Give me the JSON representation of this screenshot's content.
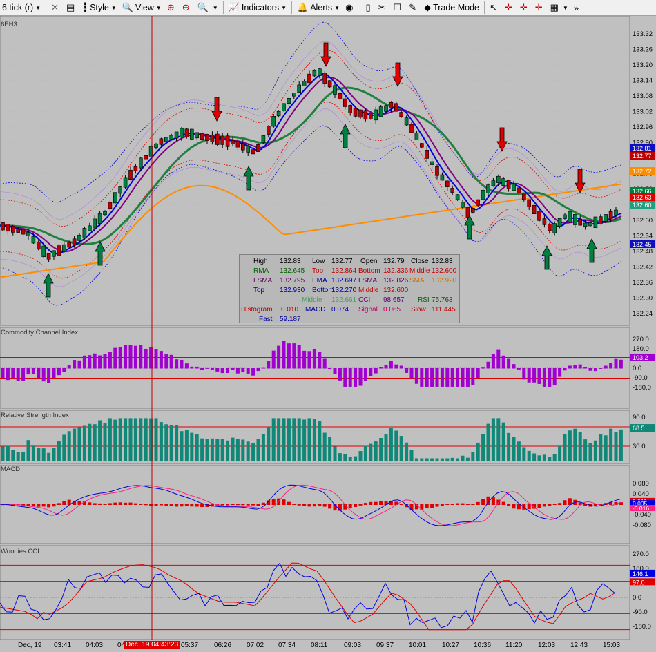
{
  "toolbar": {
    "period": "6 tick (r)",
    "style": "Style",
    "view": "View",
    "indicators": "Indicators",
    "alerts": "Alerts",
    "trade_mode": "Trade Mode"
  },
  "panels": {
    "price": {
      "label": "6EH3"
    },
    "cci": {
      "label": "Commodity Channel Index"
    },
    "rsi": {
      "label": "Relative Strength Index"
    },
    "macd": {
      "label": "MACD"
    },
    "woodies": {
      "label": "Woodies CCI"
    }
  },
  "price_axis": [
    "133.32",
    "133.26",
    "133.20",
    "133.14",
    "133.08",
    "133.02",
    "132.96",
    "132.90",
    "132.84",
    "132.78",
    "132.72",
    "132.66",
    "132.60",
    "132.54",
    "132.48",
    "132.42",
    "132.36",
    "132.30",
    "132.24"
  ],
  "price_boxes": [
    {
      "text": "132.81",
      "color": "#1010c0"
    },
    {
      "text": "132.77",
      "color": "#c00000"
    },
    {
      "text": "132.72",
      "color": "#ff8c00"
    },
    {
      "text": "132.66",
      "color": "#008040"
    },
    {
      "text": "132.63",
      "color": "#e00000"
    },
    {
      "text": "132.60",
      "color": "#20a080"
    },
    {
      "text": "132.45",
      "color": "#1010c0"
    }
  ],
  "cci_axis": [
    "270.0",
    "180.0",
    "90.0",
    "0.0",
    "-90.0",
    "-180.0"
  ],
  "cci_box": "103.2",
  "rsi_axis": [
    "90.0",
    "30.0"
  ],
  "rsi_box": "68.5",
  "macd_axis": [
    "0.080",
    "0.040",
    "0.000",
    "-0.040",
    "-0.080"
  ],
  "macd_boxes": [
    "0.011",
    "0.005",
    "-0.016"
  ],
  "woodies_axis": [
    "270.0",
    "180.0",
    "90.0",
    "0.0",
    "-90.0",
    "-180.0"
  ],
  "woodies_boxes": [
    "146.1",
    "97.0"
  ],
  "legend": {
    "r1": [
      "High",
      "132.83",
      "Low",
      "132.77",
      "Open",
      "132.79",
      "Close",
      "132.83"
    ],
    "r2": [
      "RMA",
      "132.645",
      "Top",
      "132.864",
      "Bottom",
      "132.336",
      "Middle",
      "132.600"
    ],
    "r3": [
      "LSMA",
      "132.795",
      "EMA",
      "132.697",
      "LSMA",
      "132.826",
      "SMA",
      "132.920"
    ],
    "r4": [
      "Top",
      "132.930",
      "Bottom",
      "132.270",
      "Middle",
      "132.600"
    ],
    "r5": [
      "Middle",
      "132.661",
      "CCI",
      "98.657",
      "RSI",
      "75.763"
    ],
    "r6": [
      "Histogram",
      "0.010",
      "MACD",
      "0.074",
      "Signal",
      "0.065",
      "Slow",
      "111.445"
    ],
    "r7": [
      "Fast",
      "59.187"
    ]
  },
  "time_axis": [
    "Dec, 19",
    "03:41",
    "04:03",
    "04",
    "05:37",
    "06:26",
    "07:02",
    "07:34",
    "08:11",
    "09:03",
    "09:37",
    "10:01",
    "10:27",
    "10:36",
    "11:20",
    "12:03",
    "12:43",
    "15:03"
  ],
  "cursor_time": "Dec. 19 04:43:23",
  "colors": {
    "bull": "#008040",
    "bear": "#c00000",
    "ema_orange": "#ff8c00",
    "ema_green": "#208040",
    "lsma_blue": "#0000e0",
    "rma_purple": "#800080",
    "bb_red": "#e00000",
    "bb_blue": "#0000e0",
    "cursor": "#c00000"
  }
}
